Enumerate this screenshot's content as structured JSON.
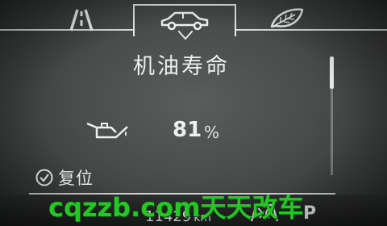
{
  "screen": {
    "title": "机油寿命",
    "oil_life": {
      "value": "81",
      "unit": "%",
      "fraction": 0.81
    },
    "reset_label": "复位"
  },
  "tabs": [
    {
      "id": "road",
      "icon": "road-lanes-icon",
      "selected": false
    },
    {
      "id": "vehicle",
      "icon": "car-icon",
      "selected": true
    },
    {
      "id": "eco",
      "icon": "leaf-icon",
      "selected": false
    }
  ],
  "status_bar": {
    "odometer": "11429",
    "odometer_unit": "km",
    "gear": "P",
    "dsc_icon": "stability-control-off-icon"
  },
  "watermark": "cqzzb.com天天改车",
  "colors": {
    "text": "#eef0ee",
    "background": "#4a4c4b",
    "watermark": "#27c527"
  }
}
